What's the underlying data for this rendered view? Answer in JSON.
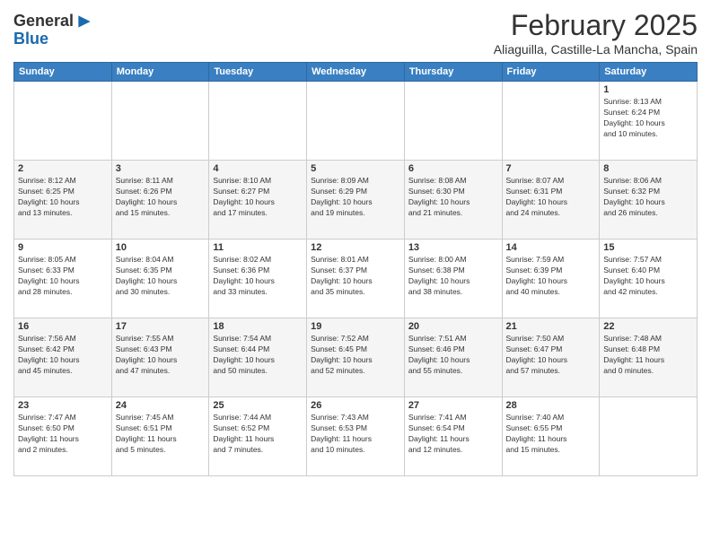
{
  "header": {
    "logo_general": "General",
    "logo_blue": "Blue",
    "month_title": "February 2025",
    "location": "Aliaguilla, Castille-La Mancha, Spain"
  },
  "weekdays": [
    "Sunday",
    "Monday",
    "Tuesday",
    "Wednesday",
    "Thursday",
    "Friday",
    "Saturday"
  ],
  "weeks": [
    [
      {
        "day": "",
        "info": ""
      },
      {
        "day": "",
        "info": ""
      },
      {
        "day": "",
        "info": ""
      },
      {
        "day": "",
        "info": ""
      },
      {
        "day": "",
        "info": ""
      },
      {
        "day": "",
        "info": ""
      },
      {
        "day": "1",
        "info": "Sunrise: 8:13 AM\nSunset: 6:24 PM\nDaylight: 10 hours\nand 10 minutes."
      }
    ],
    [
      {
        "day": "2",
        "info": "Sunrise: 8:12 AM\nSunset: 6:25 PM\nDaylight: 10 hours\nand 13 minutes."
      },
      {
        "day": "3",
        "info": "Sunrise: 8:11 AM\nSunset: 6:26 PM\nDaylight: 10 hours\nand 15 minutes."
      },
      {
        "day": "4",
        "info": "Sunrise: 8:10 AM\nSunset: 6:27 PM\nDaylight: 10 hours\nand 17 minutes."
      },
      {
        "day": "5",
        "info": "Sunrise: 8:09 AM\nSunset: 6:29 PM\nDaylight: 10 hours\nand 19 minutes."
      },
      {
        "day": "6",
        "info": "Sunrise: 8:08 AM\nSunset: 6:30 PM\nDaylight: 10 hours\nand 21 minutes."
      },
      {
        "day": "7",
        "info": "Sunrise: 8:07 AM\nSunset: 6:31 PM\nDaylight: 10 hours\nand 24 minutes."
      },
      {
        "day": "8",
        "info": "Sunrise: 8:06 AM\nSunset: 6:32 PM\nDaylight: 10 hours\nand 26 minutes."
      }
    ],
    [
      {
        "day": "9",
        "info": "Sunrise: 8:05 AM\nSunset: 6:33 PM\nDaylight: 10 hours\nand 28 minutes."
      },
      {
        "day": "10",
        "info": "Sunrise: 8:04 AM\nSunset: 6:35 PM\nDaylight: 10 hours\nand 30 minutes."
      },
      {
        "day": "11",
        "info": "Sunrise: 8:02 AM\nSunset: 6:36 PM\nDaylight: 10 hours\nand 33 minutes."
      },
      {
        "day": "12",
        "info": "Sunrise: 8:01 AM\nSunset: 6:37 PM\nDaylight: 10 hours\nand 35 minutes."
      },
      {
        "day": "13",
        "info": "Sunrise: 8:00 AM\nSunset: 6:38 PM\nDaylight: 10 hours\nand 38 minutes."
      },
      {
        "day": "14",
        "info": "Sunrise: 7:59 AM\nSunset: 6:39 PM\nDaylight: 10 hours\nand 40 minutes."
      },
      {
        "day": "15",
        "info": "Sunrise: 7:57 AM\nSunset: 6:40 PM\nDaylight: 10 hours\nand 42 minutes."
      }
    ],
    [
      {
        "day": "16",
        "info": "Sunrise: 7:56 AM\nSunset: 6:42 PM\nDaylight: 10 hours\nand 45 minutes."
      },
      {
        "day": "17",
        "info": "Sunrise: 7:55 AM\nSunset: 6:43 PM\nDaylight: 10 hours\nand 47 minutes."
      },
      {
        "day": "18",
        "info": "Sunrise: 7:54 AM\nSunset: 6:44 PM\nDaylight: 10 hours\nand 50 minutes."
      },
      {
        "day": "19",
        "info": "Sunrise: 7:52 AM\nSunset: 6:45 PM\nDaylight: 10 hours\nand 52 minutes."
      },
      {
        "day": "20",
        "info": "Sunrise: 7:51 AM\nSunset: 6:46 PM\nDaylight: 10 hours\nand 55 minutes."
      },
      {
        "day": "21",
        "info": "Sunrise: 7:50 AM\nSunset: 6:47 PM\nDaylight: 10 hours\nand 57 minutes."
      },
      {
        "day": "22",
        "info": "Sunrise: 7:48 AM\nSunset: 6:48 PM\nDaylight: 11 hours\nand 0 minutes."
      }
    ],
    [
      {
        "day": "23",
        "info": "Sunrise: 7:47 AM\nSunset: 6:50 PM\nDaylight: 11 hours\nand 2 minutes."
      },
      {
        "day": "24",
        "info": "Sunrise: 7:45 AM\nSunset: 6:51 PM\nDaylight: 11 hours\nand 5 minutes."
      },
      {
        "day": "25",
        "info": "Sunrise: 7:44 AM\nSunset: 6:52 PM\nDaylight: 11 hours\nand 7 minutes."
      },
      {
        "day": "26",
        "info": "Sunrise: 7:43 AM\nSunset: 6:53 PM\nDaylight: 11 hours\nand 10 minutes."
      },
      {
        "day": "27",
        "info": "Sunrise: 7:41 AM\nSunset: 6:54 PM\nDaylight: 11 hours\nand 12 minutes."
      },
      {
        "day": "28",
        "info": "Sunrise: 7:40 AM\nSunset: 6:55 PM\nDaylight: 11 hours\nand 15 minutes."
      },
      {
        "day": "",
        "info": ""
      }
    ]
  ]
}
